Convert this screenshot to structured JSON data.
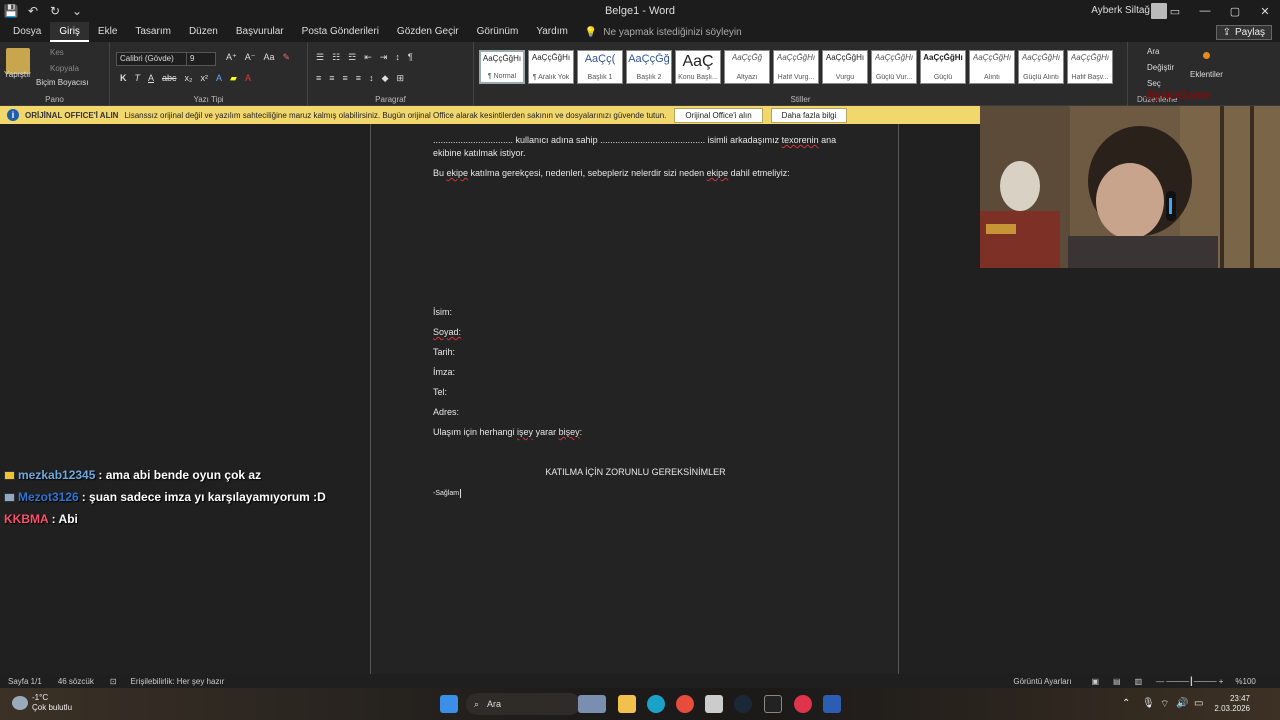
{
  "window": {
    "doc_title": "Belge1  -  Word",
    "user_name": "Ayberk Siltağ",
    "controls": [
      "—",
      "▢",
      "✕"
    ]
  },
  "menu": {
    "items": [
      "Dosya",
      "Giriş",
      "Ekle",
      "Tasarım",
      "Düzen",
      "Başvurular",
      "Posta Gönderileri",
      "Gözden Geçir",
      "Görünüm",
      "Yardım"
    ],
    "tellme": "Ne yapmak istediğinizi söyleyin",
    "share": "Paylaş"
  },
  "ribbon": {
    "paste": "Yapıştır",
    "cut": "Kes",
    "copy": "Kopyala",
    "format_painter": "Biçim Boyacısı",
    "font_name": "Calibri (Gövde)",
    "font_size": "9",
    "group_clipboard": "Pano",
    "group_font": "Yazı Tipi",
    "group_paragraph": "Paragraf",
    "group_styles": "Stiller",
    "group_editing": "Düzenleme",
    "find": "Ara",
    "replace": "Değiştir",
    "select": "Seç",
    "addins": "Eklentiler",
    "styles": [
      {
        "sample": "AaÇçĞğHı",
        "name": "¶ Normal"
      },
      {
        "sample": "AaÇçĞğHı",
        "name": "¶ Aralık Yok"
      },
      {
        "sample": "AaÇç(",
        "name": "Başlık 1"
      },
      {
        "sample": "AaÇçĞğ",
        "name": "Başlık 2"
      },
      {
        "sample": "AaÇ",
        "name": "Konu Başlı..."
      },
      {
        "sample": "AaÇçĞğ",
        "name": "Altyazı"
      },
      {
        "sample": "AaÇçĞğHı",
        "name": "Hafif Vurg..."
      },
      {
        "sample": "AaÇçĞğHı",
        "name": "Vurgu"
      },
      {
        "sample": "AaÇçĞğHı",
        "name": "Güçlü Vur..."
      },
      {
        "sample": "AaÇçĞğHı",
        "name": "Güçlü"
      },
      {
        "sample": "AaÇçĞğHı",
        "name": "Alıntı"
      },
      {
        "sample": "AaÇçĞğHı",
        "name": "Güçlü Alıntı"
      },
      {
        "sample": "AaÇçĞğHı",
        "name": "Hafif Başv..."
      }
    ]
  },
  "infobar": {
    "title": "ORİJİNAL OFFICE'İ ALIN",
    "message": "Lisanssız orijinal değil ve yazılım sahteciliğine maruz kalmış olabilirsiniz. Bugün orijinal Office alarak kesintilerden sakının ve dosyalarınızı güvende tutun.",
    "btn_get": "Orijinal Office'i alın",
    "btn_more": "Daha fazla bilgi"
  },
  "document": {
    "line1_a": "................................ kullanıcı adına sahip .......................................... isimli arkadaşımız ",
    "line1_name": "texorenin",
    "line1_b": " ana",
    "line2": "ekibine katılmak istiyor.",
    "q_a": "Bu ",
    "q_ekipe": "ekipe",
    "q_b": " katılma gerekçesi, nedenleri, sebepleriz nelerdir sizi neden ",
    "q_ekipe2": "ekipe",
    "q_c": " dahil etmeliyiz:",
    "field_isim": "İsim:",
    "field_soyad": "Soyad:",
    "field_tarih": "Tarih:",
    "field_imza": "İmza:",
    "field_tel": "Tel:",
    "field_adres": "Adres:",
    "contact_a": "Ulaşım için herhangi ",
    "contact_isey": "işey",
    "contact_b": " yarar ",
    "contact_bisey": "bişey",
    "contact_c": ":",
    "heading": "KATILMA İÇİN ZORUNLU GEREKSİNİMLER",
    "item1": "-Sağlam"
  },
  "overlay": {
    "watermark": "ByNoGame"
  },
  "chat": [
    {
      "user": "mezkab12345",
      "user_color": "#6fa8dc",
      "message": ": ama abi bende oyun çok az",
      "badge_color": "#f1c232"
    },
    {
      "user": "Mezot3126",
      "user_color": "#2e75d6",
      "message": ": şuan sadece imza yı karşılayamıyorum :D",
      "badge_color": "#8ea9c8"
    },
    {
      "user": "KKBMA",
      "user_color": "#ff4d6d",
      "message": ": Abi",
      "badge_color": ""
    }
  ],
  "status": {
    "page": "Sayfa 1/1",
    "words": "46 sözcük",
    "accessibility": "Erişilebilirlik: Her şey hazır",
    "display_settings": "Görüntü Ayarları",
    "zoom": "%100"
  },
  "taskbar": {
    "temp": "-1°C",
    "weather": "Çok bulutlu",
    "search": "Ara",
    "time": "23:47",
    "date": "2.03.2026"
  }
}
